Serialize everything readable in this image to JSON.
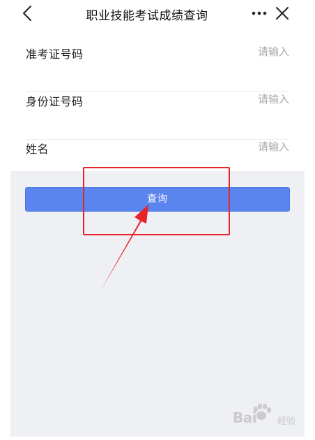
{
  "header": {
    "title": "职业技能考试成绩查询",
    "back_icon": "chevron-left-icon",
    "more_icon": "more-dots-icon",
    "close_icon": "close-icon"
  },
  "form": {
    "fields": [
      {
        "label": "准考证号码",
        "placeholder": "请输入",
        "value": ""
      },
      {
        "label": "身份证号码",
        "placeholder": "请输入",
        "value": ""
      },
      {
        "label": "姓名",
        "placeholder": "请输入",
        "value": ""
      }
    ],
    "submit_label": "查询"
  },
  "annotation": {
    "box_color": "#e8242b",
    "arrow_color": "#e8242b"
  },
  "watermark": {
    "text": "Bai",
    "suffix": "经验"
  },
  "colors": {
    "primary": "#5a84ee",
    "page_background": "#eef0f4"
  }
}
